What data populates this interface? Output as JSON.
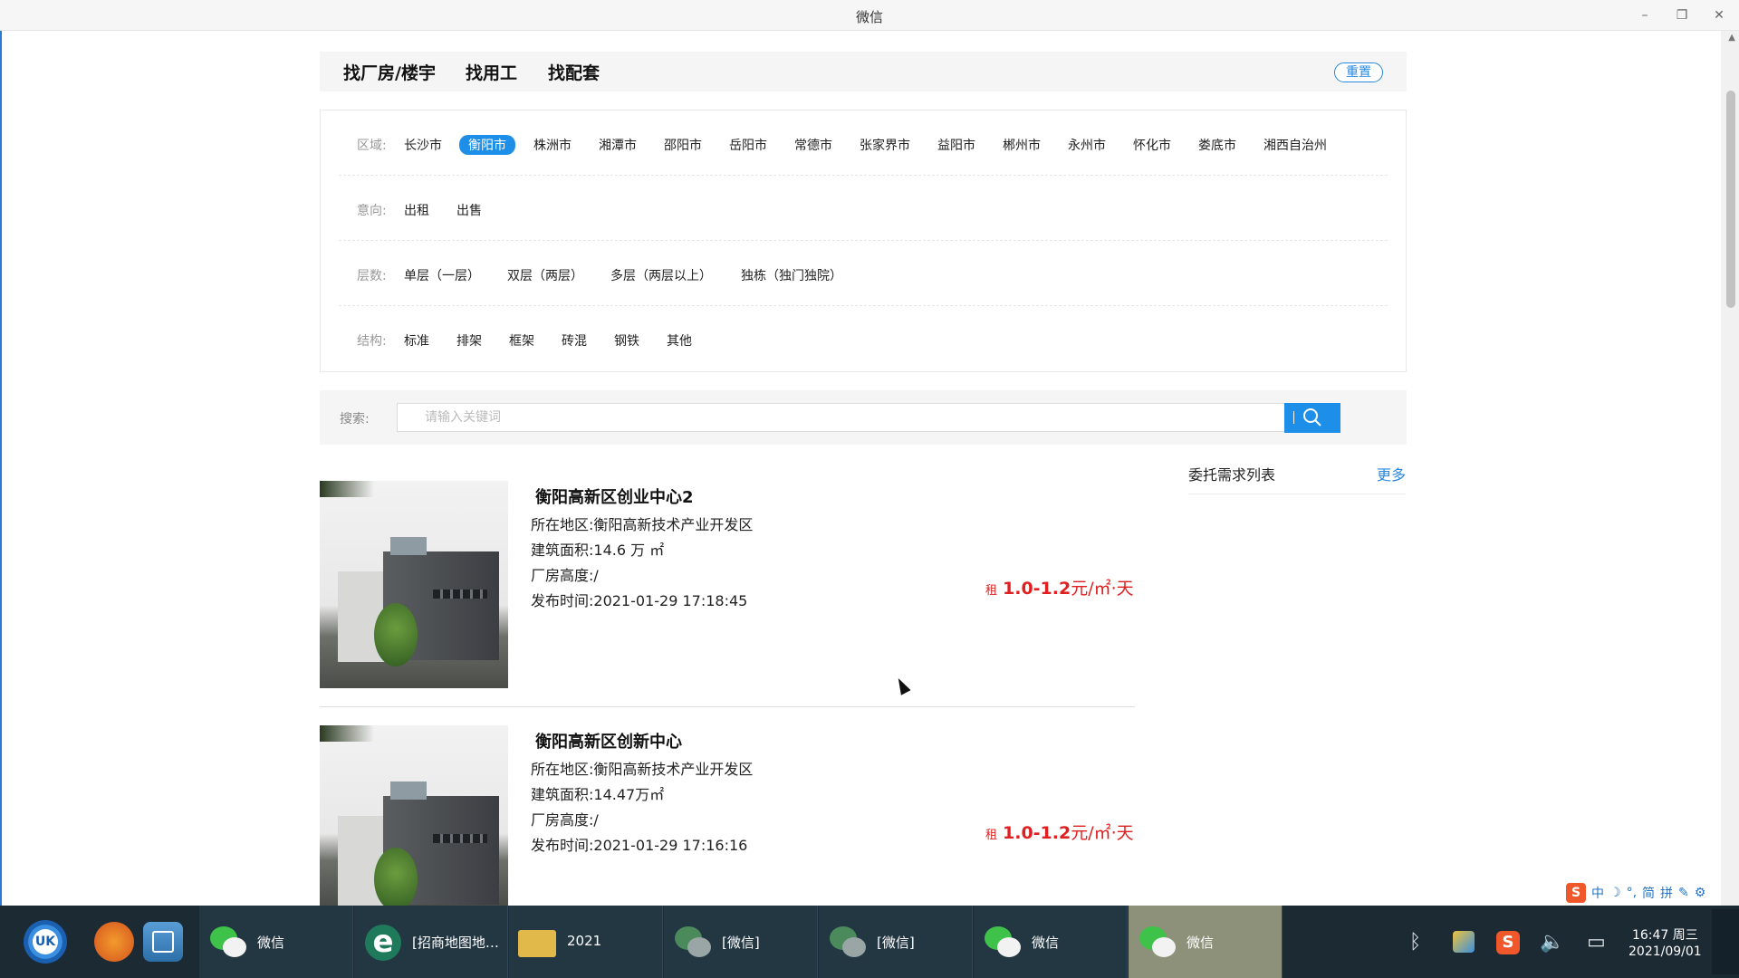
{
  "window": {
    "title": "微信"
  },
  "nav": {
    "tabs": [
      "找厂房/楼宇",
      "找用工",
      "找配套"
    ],
    "reset_label": "重置"
  },
  "filters": {
    "region": {
      "label": "区域:",
      "options": [
        "长沙市",
        "衡阳市",
        "株洲市",
        "湘潭市",
        "邵阳市",
        "岳阳市",
        "常德市",
        "张家界市",
        "益阳市",
        "郴州市",
        "永州市",
        "怀化市",
        "娄底市",
        "湘西自治州"
      ],
      "selected": "衡阳市"
    },
    "intent": {
      "label": "意向:",
      "options": [
        "出租",
        "出售"
      ]
    },
    "floors": {
      "label": "层数:",
      "options": [
        "单层（一层）",
        "双层（两层）",
        "多层（两层以上）",
        "独栋（独门独院）"
      ]
    },
    "structure": {
      "label": "结构:",
      "options": [
        "标准",
        "排架",
        "框架",
        "砖混",
        "钢铁",
        "其他"
      ]
    }
  },
  "search": {
    "label": "搜索:",
    "placeholder": "请输入关键词"
  },
  "listings": [
    {
      "title": "衡阳高新区创业中心2",
      "region": "所在地区:衡阳高新技术产业开发区",
      "area": "建筑面积:14.6 万 ㎡",
      "height": "厂房高度:/",
      "published": "发布时间:2021-01-29 17:18:45",
      "price_tag": "租",
      "price_value": "1.0-1.2",
      "price_unit": "元/㎡·天"
    },
    {
      "title": "衡阳高新区创新中心",
      "region": "所在地区:衡阳高新技术产业开发区",
      "area": "建筑面积:14.47万㎡",
      "height": "厂房高度:/",
      "published": "发布时间:2021-01-29 17:16:16",
      "price_tag": "租",
      "price_value": "1.0-1.2",
      "price_unit": "元/㎡·天"
    }
  ],
  "sidebar": {
    "title": "委托需求列表",
    "more": "更多"
  },
  "ime": {
    "logo": "S",
    "items": [
      "中",
      "☽",
      "°,",
      "简",
      "拼",
      "✎",
      "⚙"
    ]
  },
  "taskbar": {
    "tasks": [
      "微信",
      "[招商地图地…",
      "2021",
      "[微信]",
      "[微信]",
      "微信",
      "微信"
    ],
    "clock_time": "16:47 周三",
    "clock_date": "2021/09/01"
  },
  "icons": {
    "minimize": "minimize-icon",
    "restore": "restore-icon",
    "close": "close-icon",
    "search": "search-icon",
    "bluetooth": "bluetooth-icon",
    "volume": "volume-icon"
  }
}
